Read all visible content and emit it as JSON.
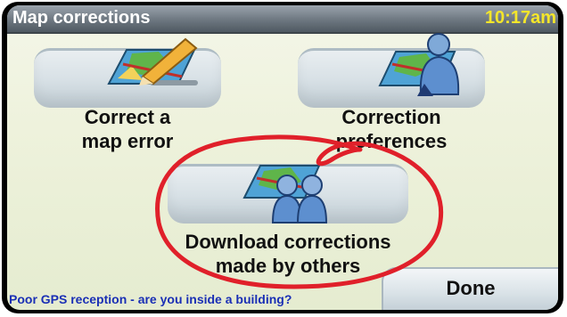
{
  "header": {
    "title": "Map corrections",
    "time": "10:17am"
  },
  "menu": {
    "correct_error": {
      "line1": "Correct a",
      "line2": "map error",
      "icon": "map-pencil-icon"
    },
    "preferences": {
      "line1": "Correction",
      "line2": "preferences",
      "icon": "map-person-icon"
    },
    "download": {
      "line1": "Download corrections",
      "line2": "made by others",
      "icon": "map-people-icon"
    }
  },
  "status": {
    "message": "Poor GPS reception - are you inside a building?"
  },
  "footer": {
    "done_label": "Done"
  },
  "colors": {
    "title_bar": "#6d7780",
    "clock": "#f4e62a",
    "status_text": "#1a2fb5",
    "annotation": "#e0202a"
  }
}
